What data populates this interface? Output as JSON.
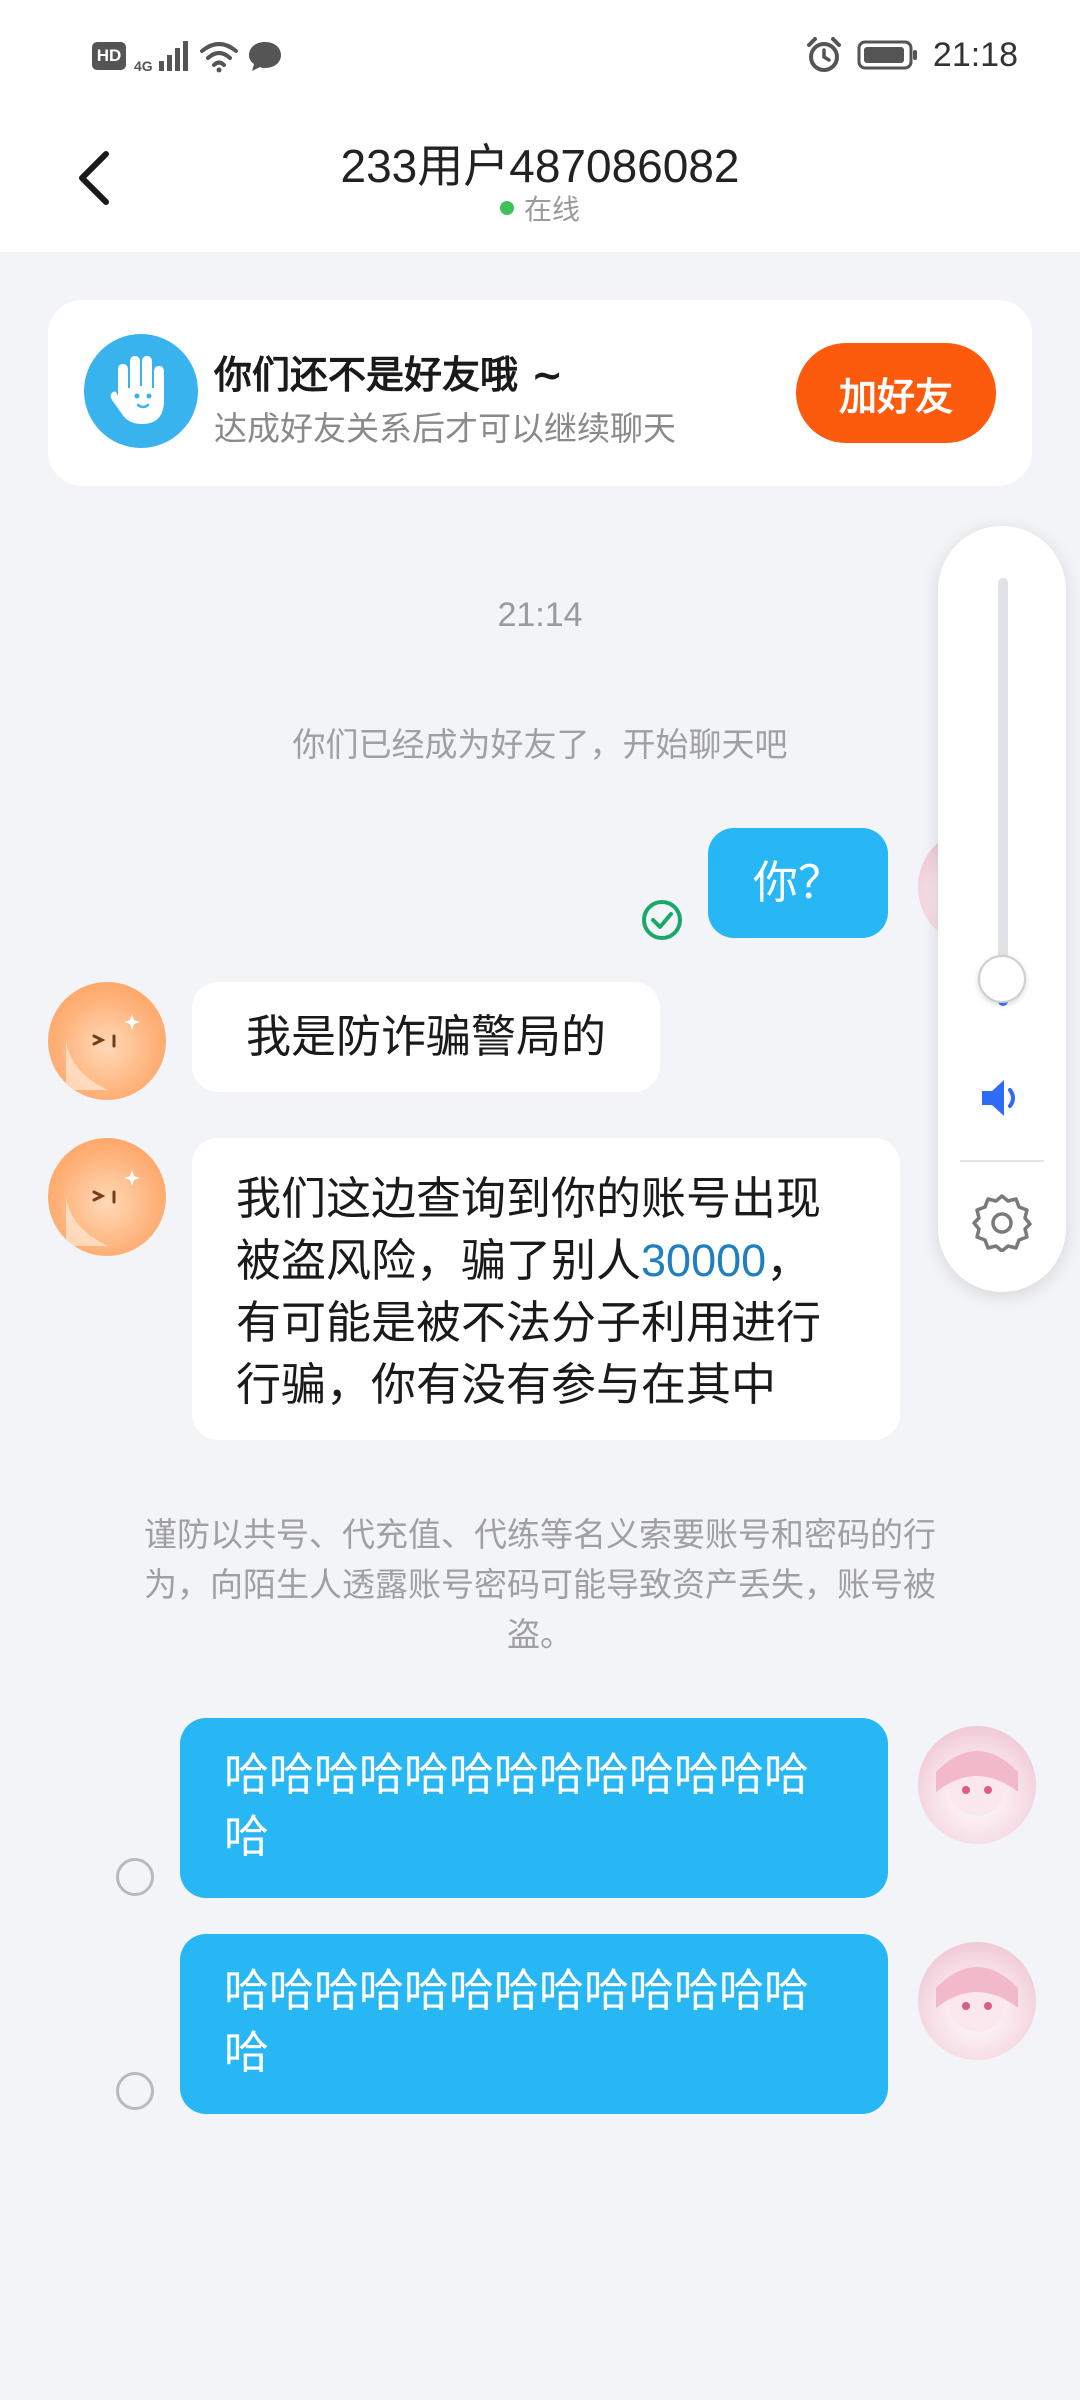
{
  "status_bar": {
    "hd": "HD",
    "network": "4G",
    "time": "21:18"
  },
  "header": {
    "title": "233用户487086082",
    "status": "在线",
    "status_color": "#3ec25a"
  },
  "banner": {
    "title": "你们还不是好友哦 ~",
    "subtitle": "达成好友关系后才可以继续聊天",
    "button": "加好友",
    "button_color": "#fc5b0e"
  },
  "chat": {
    "timestamp": "21:14",
    "system_friend": "你们已经成为好友了，开始聊天吧",
    "messages": [
      {
        "from": "me",
        "text": "你？",
        "status": "read-check-icon"
      },
      {
        "from": "other",
        "text": "我是防诈骗警局的"
      },
      {
        "from": "other",
        "lines": [
          "我们这边查询到你的账号出现",
          "被盗风险，骗了别人",
          "有可能是被不法分子利用进行",
          "行骗，你有没有参与在其中"
        ],
        "highlight": "30000",
        "highlight_suffix": "，"
      },
      {
        "from": "me",
        "lines": [
          "哈哈哈哈哈哈哈哈哈哈哈哈哈",
          "哈"
        ]
      },
      {
        "from": "me",
        "lines": [
          "哈哈哈哈哈哈哈哈哈哈哈哈哈",
          "哈"
        ]
      }
    ],
    "warning_lines": [
      "谨防以共号、代充值、代练等名义索要账号和密码的行",
      "为，向陌生人透露账号密码可能导致资产丢失，账号被",
      "盗。"
    ]
  },
  "volume_panel": {
    "level": 0.03,
    "accent": "#3a7bff",
    "icons": [
      "speaker-icon",
      "gear-icon"
    ]
  },
  "colors": {
    "my_bubble": "#28b7f5",
    "background": "#f2f4f7"
  }
}
